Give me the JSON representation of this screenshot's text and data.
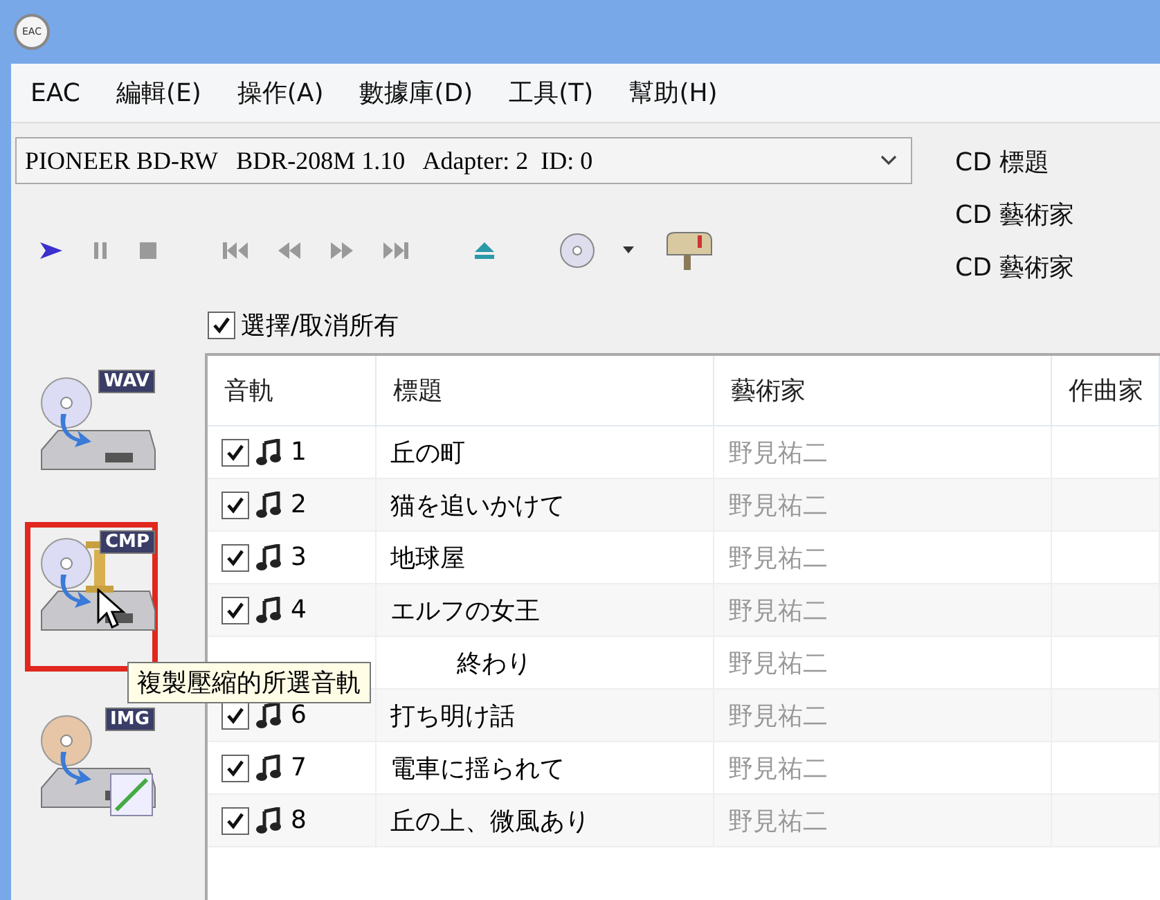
{
  "window": {
    "app_icon_label": "EAC"
  },
  "menu": [
    "EAC",
    "編輯(E)",
    "操作(A)",
    "數據庫(D)",
    "工具(T)",
    "幫助(H)"
  ],
  "drive": {
    "value": "PIONEER BD-RW   BDR-208M 1.10   Adapter: 2  ID: 0"
  },
  "cd_fields": [
    "CD 標題",
    "CD 藝術家",
    "CD 藝術家"
  ],
  "select_all": {
    "label": "選擇/取消所有",
    "checked": true
  },
  "actions": [
    {
      "kind": "wav",
      "badge": "WAV",
      "highlighted": false
    },
    {
      "kind": "cmp",
      "badge": "CMP",
      "highlighted": true
    },
    {
      "kind": "img",
      "badge": "IMG",
      "highlighted": false
    }
  ],
  "tooltip": "複製壓縮的所選音軌",
  "table": {
    "columns": [
      "音軌",
      "標題",
      "藝術家",
      "作曲家"
    ],
    "rows": [
      {
        "kind": "full",
        "checked": true,
        "track": "1",
        "title": "丘の町",
        "artist": "野見祐二"
      },
      {
        "kind": "full",
        "checked": true,
        "track": "2",
        "title": "猫を追いかけて",
        "artist": "野見祐二"
      },
      {
        "kind": "full",
        "checked": true,
        "track": "3",
        "title": "地球屋",
        "artist": "野見祐二"
      },
      {
        "kind": "full",
        "checked": true,
        "track": "4",
        "title": "エルフの女王",
        "artist": "野見祐二"
      },
      {
        "kind": "partial",
        "title": "終わり",
        "artist": "野見祐二"
      },
      {
        "kind": "full",
        "checked": true,
        "track": "6",
        "title": "打ち明け話",
        "artist": "野見祐二"
      },
      {
        "kind": "full",
        "checked": true,
        "track": "7",
        "title": "電車に揺られて",
        "artist": "野見祐二"
      },
      {
        "kind": "full",
        "checked": true,
        "track": "8",
        "title": "丘の上、微風あり",
        "artist": "野見祐二"
      }
    ]
  }
}
